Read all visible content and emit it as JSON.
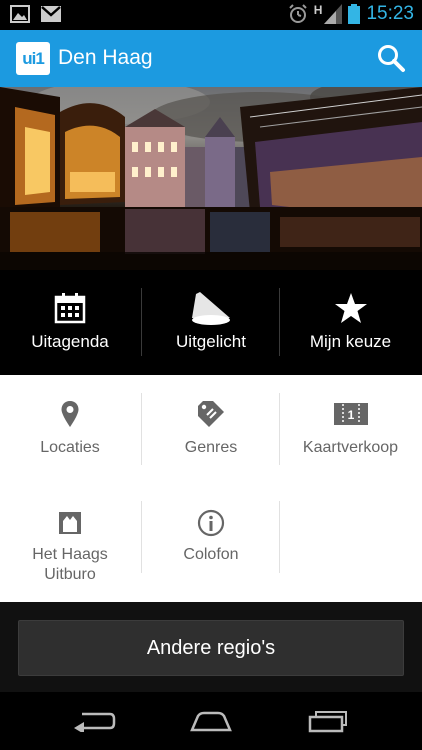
{
  "status_bar": {
    "time": "15:23",
    "network": "H"
  },
  "app_bar": {
    "logo_text": "ui1",
    "title": "Den Haag"
  },
  "main_nav": [
    {
      "label": "Uitagenda",
      "icon": "calendar-icon"
    },
    {
      "label": "Uitgelicht",
      "icon": "spotlight-icon"
    },
    {
      "label": "Mijn keuze",
      "icon": "star-icon"
    }
  ],
  "grid": [
    {
      "label": "Locaties",
      "icon": "location-pin-icon"
    },
    {
      "label": "Genres",
      "icon": "tag-icon"
    },
    {
      "label": "Kaartverkoop",
      "icon": "ticket-icon"
    },
    {
      "label": "Het Haags\nUitburo",
      "label_line1": "Het Haags",
      "label_line2": "Uitburo",
      "icon": "store-icon"
    },
    {
      "label": "Colofon",
      "icon": "info-icon"
    }
  ],
  "regio_button": {
    "label": "Andere regio's"
  },
  "colors": {
    "app_bar": "#1c9ae0",
    "clock": "#33b5e5",
    "grid_text": "#666666"
  }
}
